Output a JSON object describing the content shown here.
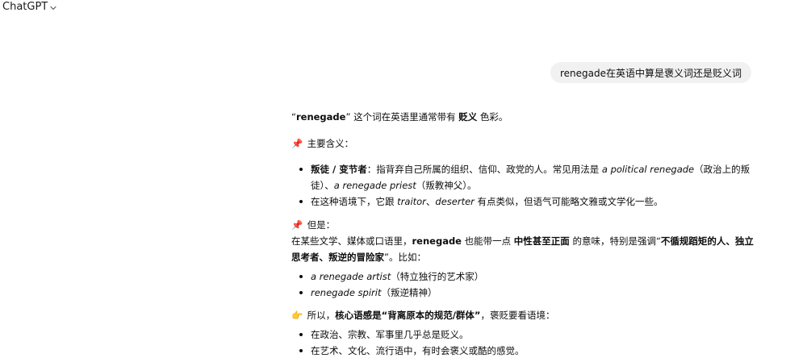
{
  "header": {
    "model_name": "ChatGPT"
  },
  "user_message": "renegade在英语中算是褒义词还是贬义词",
  "answer": {
    "intro": {
      "q_open": "“",
      "word": "renegade",
      "q_close": "”",
      "mid": " 这个词在英语里通常带有 ",
      "bold": "贬义",
      "end": " 色彩。"
    },
    "section1": {
      "emoji": "📌",
      "heading": " 主要含义："
    },
    "bullets1": [
      {
        "bold": "叛徒 / 变节者",
        "t1": "：指背弃自己所属的组织、信仰、政党的人。常见用法是 ",
        "i1": "a political renegade",
        "t2": "（政治上的叛徒）、",
        "i2": "a renegade priest",
        "t3": "（叛教神父）。"
      },
      {
        "t1": "在这种语境下，它跟 ",
        "i1": "traitor",
        "t2": "、",
        "i2": "deserter",
        "t3": " 有点类似，但语气可能略文雅或文学化一些。"
      }
    ],
    "section2": {
      "emoji": "📌",
      "heading": " 但是：",
      "t1": "在某些文学、媒体或口语里，",
      "b1": "renegade",
      "t2": " 也能带一点 ",
      "b2": "中性甚至正面",
      "t3": " 的意味，特别是强调“",
      "b3": "不循规蹈矩的人、独立思考者、叛逆的冒险家",
      "t4": "”。比如："
    },
    "bullets2": [
      {
        "i": "a renegade artist",
        "t": "（特立独行的艺术家）"
      },
      {
        "i": "renegade spirit",
        "t": "（叛逆精神）"
      }
    ],
    "section3": {
      "emoji": "👉",
      "t1": " 所以，",
      "b1": "核心语感是“背离原本的规范/群体”",
      "t2": "，褒贬要看语境："
    },
    "bullets3": [
      "在政治、宗教、军事里几乎总是贬义。",
      "在艺术、文化、流行语中，有时会褒义或酷的感觉。"
    ]
  },
  "colors": {
    "user_bubble_bg": "#f1f1f1",
    "text": "#0d0d0d"
  }
}
